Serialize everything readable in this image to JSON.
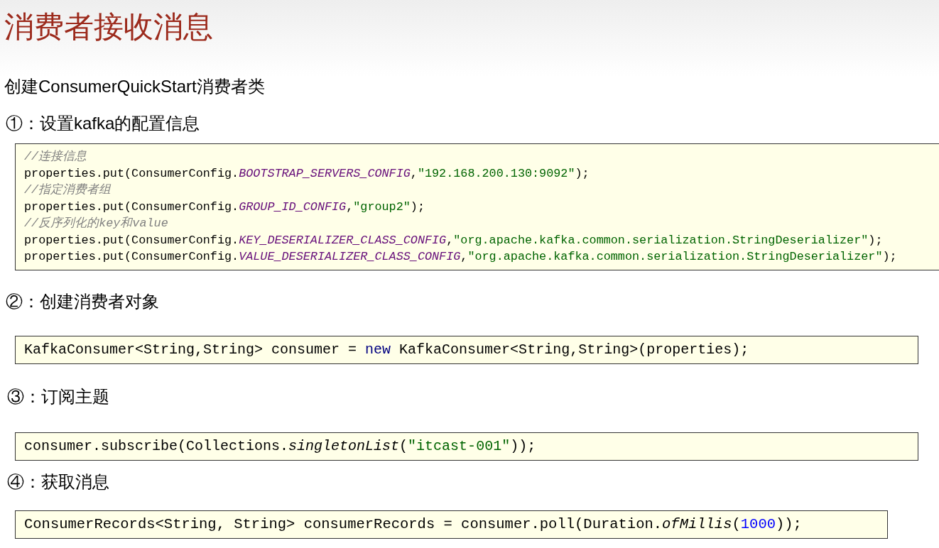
{
  "title": "消费者接收消息",
  "intro": "创建ConsumerQuickStart消费者类",
  "steps": [
    {
      "heading": "①：设置kafka的配置信息",
      "code": [
        [
          {
            "kind": "comment",
            "text": "//连接信息"
          }
        ],
        [
          {
            "kind": "plain",
            "text": "properties.put(ConsumerConfig."
          },
          {
            "kind": "constant",
            "text": "BOOTSTRAP_SERVERS_CONFIG"
          },
          {
            "kind": "plain",
            "text": ","
          },
          {
            "kind": "string",
            "text": "\"192.168.200.130:9092\""
          },
          {
            "kind": "plain",
            "text": ");"
          }
        ],
        [
          {
            "kind": "comment",
            "text": "//指定消费者组"
          }
        ],
        [
          {
            "kind": "plain",
            "text": "properties.put(ConsumerConfig."
          },
          {
            "kind": "constant",
            "text": "GROUP_ID_CONFIG"
          },
          {
            "kind": "plain",
            "text": ","
          },
          {
            "kind": "string",
            "text": "\"group2\""
          },
          {
            "kind": "plain",
            "text": ");"
          }
        ],
        [
          {
            "kind": "comment",
            "text": "//反序列化的key和value"
          }
        ],
        [
          {
            "kind": "plain",
            "text": "properties.put(ConsumerConfig."
          },
          {
            "kind": "constant",
            "text": "KEY_DESERIALIZER_CLASS_CONFIG"
          },
          {
            "kind": "plain",
            "text": ","
          },
          {
            "kind": "string",
            "text": "\"org.apache.kafka.common.serialization.StringDeserializer\""
          },
          {
            "kind": "plain",
            "text": ");"
          }
        ],
        [
          {
            "kind": "plain",
            "text": "properties.put(ConsumerConfig."
          },
          {
            "kind": "constant",
            "text": "VALUE_DESERIALIZER_CLASS_CONFIG"
          },
          {
            "kind": "plain",
            "text": ","
          },
          {
            "kind": "string",
            "text": "\"org.apache.kafka.common.serialization.StringDeserializer\""
          },
          {
            "kind": "plain",
            "text": ");"
          }
        ]
      ]
    },
    {
      "heading": "②：创建消费者对象",
      "code": [
        [
          {
            "kind": "plain",
            "text": "KafkaConsumer<String,String> consumer = "
          },
          {
            "kind": "keyword",
            "text": "new"
          },
          {
            "kind": "plain",
            "text": " KafkaConsumer<String,String>(properties);"
          }
        ]
      ]
    },
    {
      "heading": "③：订阅主题",
      "code": [
        [
          {
            "kind": "plain",
            "text": "consumer.subscribe(Collections."
          },
          {
            "kind": "method",
            "text": "singletonList"
          },
          {
            "kind": "plain",
            "text": "("
          },
          {
            "kind": "string",
            "text": "\"itcast-001\""
          },
          {
            "kind": "plain",
            "text": "));"
          }
        ]
      ]
    },
    {
      "heading": "④：获取消息",
      "code": [
        [
          {
            "kind": "plain",
            "text": "ConsumerRecords<String, String> consumerRecords = consumer.poll(Duration."
          },
          {
            "kind": "method",
            "text": "ofMillis"
          },
          {
            "kind": "plain",
            "text": "("
          },
          {
            "kind": "number",
            "text": "1000"
          },
          {
            "kind": "plain",
            "text": "));"
          }
        ]
      ]
    }
  ]
}
